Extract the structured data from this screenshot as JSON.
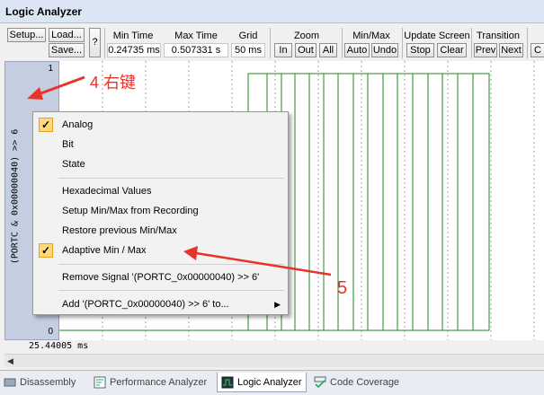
{
  "window": {
    "title": "Logic Analyzer"
  },
  "toolbar": {
    "setup": "Setup...",
    "load": "Load...",
    "save": "Save...",
    "help": "?",
    "min_time": {
      "label": "Min Time",
      "value": "0.24735 ms"
    },
    "max_time": {
      "label": "Max Time",
      "value": "0.507331 s"
    },
    "grid": {
      "label": "Grid",
      "value": "50 ms"
    },
    "zoom": {
      "label": "Zoom",
      "in": "In",
      "out": "Out",
      "all": "All"
    },
    "minmax": {
      "label": "Min/Max",
      "auto": "Auto",
      "undo": "Undo"
    },
    "update": {
      "label": "Update Screen",
      "stop": "Stop",
      "clear": "Clear"
    },
    "transition": {
      "label": "Transition",
      "prev": "Prev",
      "next": "Next"
    },
    "trailing_clip": "C"
  },
  "signal": {
    "name": "(PORTC & 0x00000040) >> 6",
    "max_tick": "1",
    "min_tick": "0"
  },
  "timeline": {
    "cursor_time": "25.44005 ms"
  },
  "context_menu": {
    "analog": "Analog",
    "bit": "Bit",
    "state": "State",
    "hex": "Hexadecimal Values",
    "setup_minmax": "Setup Min/Max from Recording",
    "restore_minmax": "Restore previous Min/Max",
    "adaptive": "Adaptive Min / Max",
    "remove": "Remove Signal '(PORTC_0x00000040) >> 6'",
    "add": "Add '(PORTC_0x00000040) >> 6' to...",
    "check_mark": "✓",
    "submenu_arrow": "▶"
  },
  "annotations": {
    "right_click": "4 右键",
    "step5": "5",
    "color": "#e8332a"
  },
  "tabs": {
    "disassembly": "Disassembly",
    "performance": "Performance Analyzer",
    "logic": "Logic Analyzer",
    "coverage": "Code Coverage"
  },
  "colors": {
    "waveform": "#1e8a1e",
    "grid": "#a0a0a0",
    "signal_panel": "#c5cde0"
  }
}
